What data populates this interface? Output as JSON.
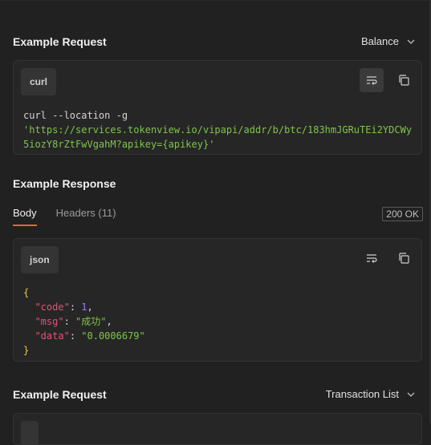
{
  "request1": {
    "title": "Example Request",
    "dropdown": "Balance",
    "language": "curl",
    "code_line1": "curl --location -g",
    "code_line2": "'https://services.tokenview.io/vipapi/addr/b/btc/183hmJGRuTEi2YDCWy",
    "code_line3": "5iozY8rZtFwVgahM?apikey={apikey}'"
  },
  "response": {
    "title": "Example Response",
    "tabs": [
      {
        "label": "Body",
        "active": true
      },
      {
        "label": "Headers (11)",
        "active": false
      }
    ],
    "status": "200 OK",
    "language": "json",
    "code": {
      "open": "{",
      "close": "}",
      "entries": [
        {
          "key": "\"code\"",
          "value": "1",
          "type": "number"
        },
        {
          "key": "\"msg\"",
          "value": "\"成功\"",
          "type": "string"
        },
        {
          "key": "\"data\"",
          "value": "\"0.0006679\"",
          "type": "string"
        }
      ]
    }
  },
  "request2": {
    "title": "Example Request",
    "dropdown": "Transaction List"
  },
  "colors": {
    "background": "#212121",
    "panel": "#262626",
    "accent_tab": "#e0653c",
    "string": "#7fc54a",
    "key": "#ea4f79",
    "number": "#9e7bff",
    "brace": "#e8c94a"
  },
  "icons": [
    "chevron-down-icon",
    "wrap-lines-icon",
    "copy-icon"
  ]
}
